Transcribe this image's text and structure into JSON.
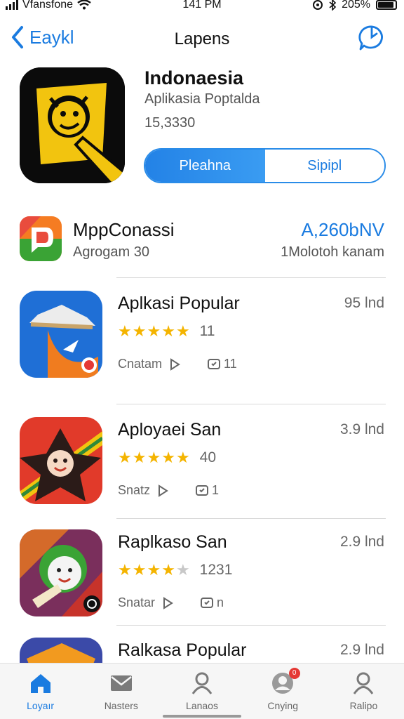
{
  "status_bar": {
    "carrier": "Vfansfone",
    "time": "141 PM",
    "battery": "205%"
  },
  "nav": {
    "back_label": "Eaykl",
    "title": "Lapens"
  },
  "hero": {
    "title": "Indonaesia",
    "subtitle": "Aplikasia Poptalda",
    "count": "15,3330",
    "segments": [
      "Pleahna",
      "Sipipl"
    ]
  },
  "featured": {
    "name": "MppConassi",
    "subtitle": "Agrogam 30",
    "price": "A,260bNV",
    "downloads": "1Molotoh kanam"
  },
  "apps": [
    {
      "name": "Aplkasi Popular",
      "size": "95 lnd",
      "rating": 4.5,
      "rating_count": "11",
      "meta_label": "Cnatam",
      "meta_count": "11"
    },
    {
      "name": "Aployaei San",
      "size": "3.9 lnd",
      "rating": 4.5,
      "rating_count": "40",
      "meta_label": "Snatz",
      "meta_count": "1"
    },
    {
      "name": "Raplkaso San",
      "size": "2.9 lnd",
      "rating": 4,
      "rating_count": "1231",
      "meta_label": "Snatar",
      "meta_count": "n"
    },
    {
      "name": "Ralkasa Popular",
      "size": "2.9 lnd"
    }
  ],
  "tabs": [
    {
      "label": "Loyaır",
      "icon": "home-icon"
    },
    {
      "label": "Nasters",
      "icon": "mail-icon"
    },
    {
      "label": "Lanaos",
      "icon": "person-icon"
    },
    {
      "label": "Cnying",
      "icon": "profile-badge-icon",
      "badge": "0"
    },
    {
      "label": "Ralipo",
      "icon": "person-icon"
    }
  ],
  "colors": {
    "accent": "#1a7be0",
    "star": "#f4b400",
    "badge": "#e53935"
  }
}
